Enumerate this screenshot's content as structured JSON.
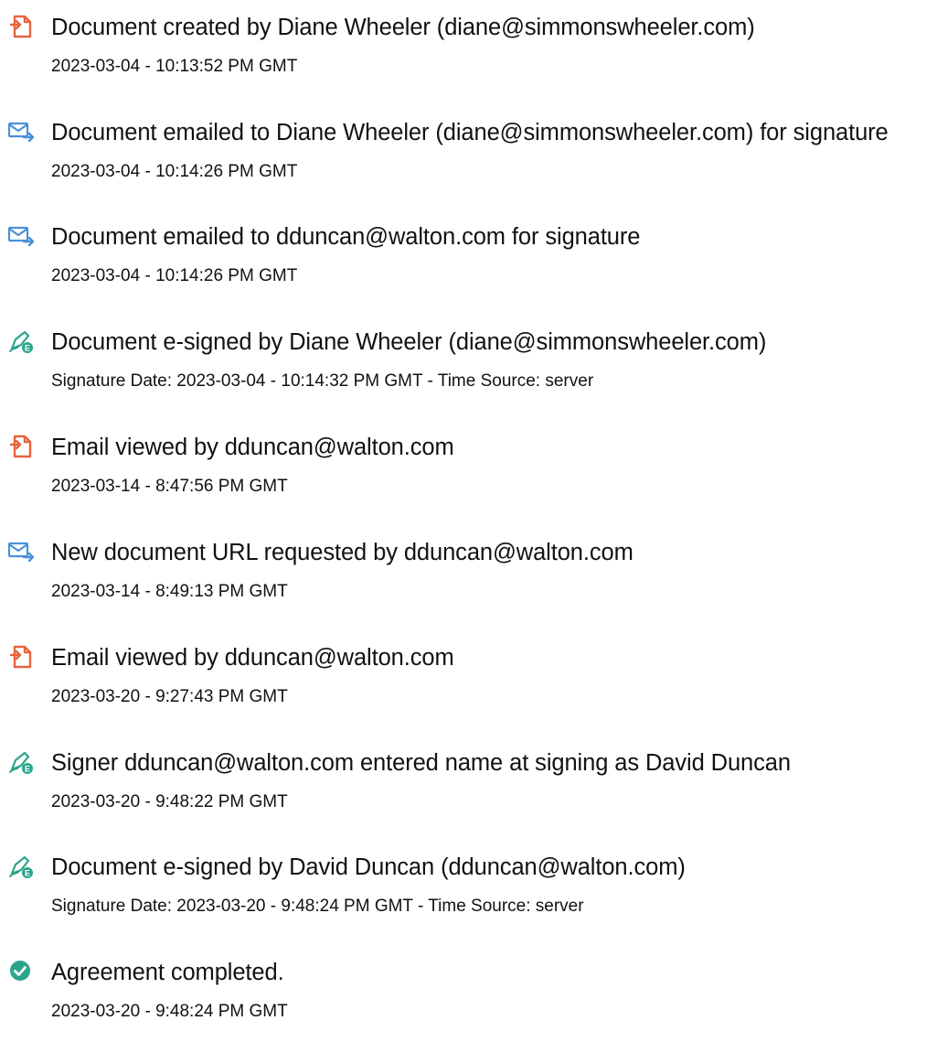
{
  "colors": {
    "doc_icon": "#e8633f",
    "email_icon": "#4a90d9",
    "sign_icon": "#2aa58b",
    "check_icon": "#2aa58b",
    "text": "#111111"
  },
  "events": [
    {
      "icon": "document-icon",
      "title": "Document created by Diane Wheeler (diane@simmonswheeler.com)",
      "subtitle": "2023-03-04 - 10:13:52 PM GMT"
    },
    {
      "icon": "email-forward-icon",
      "title": "Document emailed to Diane Wheeler (diane@simmonswheeler.com) for signature",
      "subtitle": "2023-03-04 - 10:14:26 PM GMT"
    },
    {
      "icon": "email-forward-icon",
      "title": "Document emailed to dduncan@walton.com for signature",
      "subtitle": "2023-03-04 - 10:14:26 PM GMT"
    },
    {
      "icon": "e-sign-icon",
      "title": "Document e-signed by Diane Wheeler (diane@simmonswheeler.com)",
      "subtitle": "Signature Date: 2023-03-04 - 10:14:32 PM GMT - Time Source: server"
    },
    {
      "icon": "document-icon",
      "title": "Email viewed by dduncan@walton.com",
      "subtitle": "2023-03-14 - 8:47:56 PM GMT"
    },
    {
      "icon": "email-forward-icon",
      "title": "New document URL requested by dduncan@walton.com",
      "subtitle": "2023-03-14 - 8:49:13 PM GMT"
    },
    {
      "icon": "document-icon",
      "title": "Email viewed by dduncan@walton.com",
      "subtitle": "2023-03-20 - 9:27:43 PM GMT"
    },
    {
      "icon": "e-sign-icon",
      "title": "Signer dduncan@walton.com entered name at signing as David Duncan",
      "subtitle": "2023-03-20 - 9:48:22 PM GMT"
    },
    {
      "icon": "e-sign-icon",
      "title": "Document e-signed by David Duncan (dduncan@walton.com)",
      "subtitle": "Signature Date: 2023-03-20 - 9:48:24 PM GMT - Time Source: server"
    },
    {
      "icon": "check-circle-icon",
      "title": "Agreement completed.",
      "subtitle": "2023-03-20 - 9:48:24 PM GMT"
    }
  ]
}
